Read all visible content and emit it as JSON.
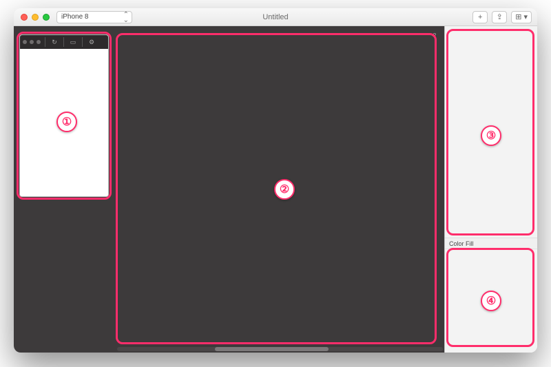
{
  "window": {
    "title": "Untitled",
    "device_selected": "iPhone 8"
  },
  "titlebar_buttons": {
    "add": "+",
    "share": "⇪",
    "layout": "⊞ ▾"
  },
  "inspector": {
    "section_label": "Color Fill"
  },
  "icons": {
    "search": "⌕",
    "rotate": "↻",
    "align": "▭",
    "settings": "⚙"
  },
  "annotations": {
    "r1": "①",
    "r2": "②",
    "r3": "③",
    "r4": "④"
  }
}
